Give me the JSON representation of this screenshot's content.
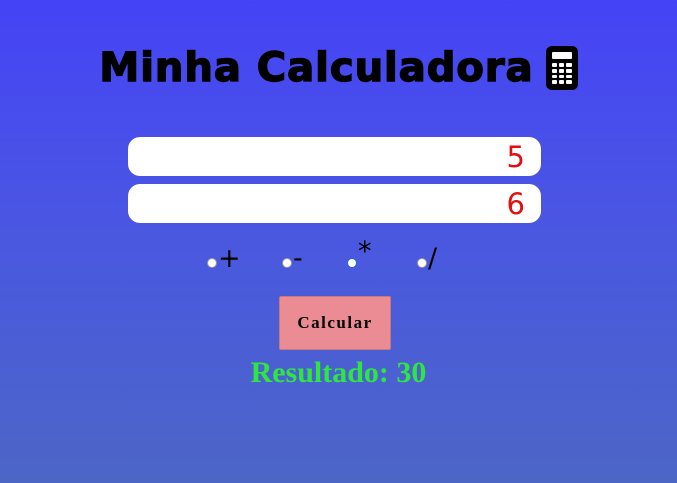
{
  "header": {
    "title": "Minha Calculadora",
    "icon": "calculator-icon"
  },
  "inputs": {
    "first_number": "5",
    "second_number": "6"
  },
  "operations": [
    {
      "label": "+",
      "checked": false
    },
    {
      "label": "-",
      "checked": false
    },
    {
      "label": "*",
      "checked": true
    },
    {
      "label": "/",
      "checked": false
    }
  ],
  "actions": {
    "calculate_label": "Calcular"
  },
  "result": {
    "text": "Resultado: 30"
  },
  "colors": {
    "background_top": "#4543f6",
    "background_bottom": "#4c66c6",
    "input_text": "#e10f0f",
    "button_bg": "#eb8c94",
    "result_text": "#2ee63f"
  }
}
